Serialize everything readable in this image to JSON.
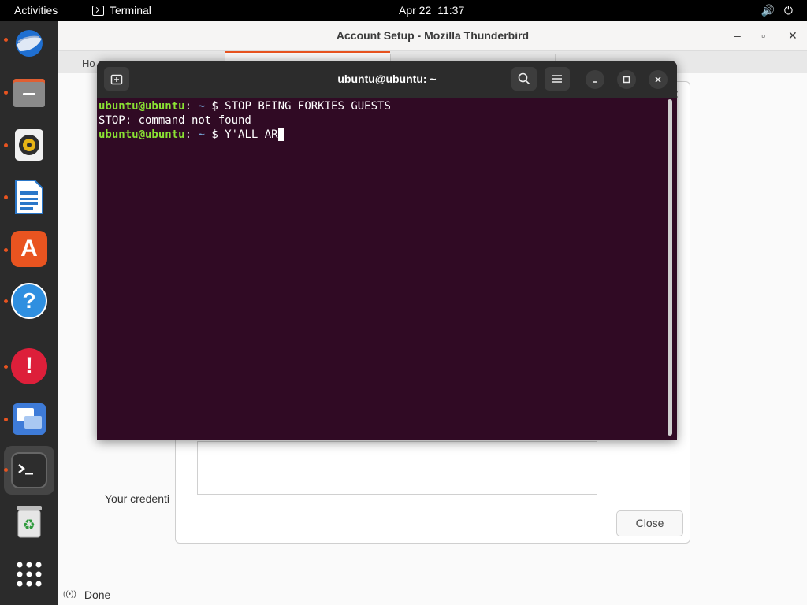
{
  "topbar": {
    "activities": "Activities",
    "app_name": "Terminal",
    "date": "Apr 22",
    "time": "11:37",
    "volume_icon": "🔊",
    "power_icon": "⏻"
  },
  "dock": {
    "items": [
      {
        "name": "thunderbird",
        "running": true
      },
      {
        "name": "files",
        "running": true
      },
      {
        "name": "rhythmbox",
        "running": true
      },
      {
        "name": "libreoffice-writer",
        "running": true
      },
      {
        "name": "app-center",
        "running": true
      },
      {
        "name": "help",
        "running": true
      },
      {
        "name": "update-notifier",
        "running": true
      },
      {
        "name": "workspaces",
        "running": true
      },
      {
        "name": "terminal",
        "running": true,
        "active": true
      },
      {
        "name": "trash",
        "running": false
      }
    ],
    "apps_grid": "show-apps",
    "help_glyph": "?",
    "alert_glyph": "!",
    "software_glyph": "A",
    "trash_glyph": "♻"
  },
  "thunderbird": {
    "title": "Account Setup - Mozilla Thunderbird",
    "controls": {
      "minimize": "–",
      "maximize": "▫",
      "close": "✕"
    },
    "tabs": [
      {
        "label": "Ho"
      }
    ],
    "status_text": "Done",
    "status_icon": "((•))"
  },
  "dialog": {
    "close_button": "Close",
    "partial_text": "Your credenti"
  },
  "terminal": {
    "title": "ubuntu@ubuntu: ~",
    "lines": [
      {
        "user": "ubuntu@ubuntu",
        "sep": ":",
        "path": " ~",
        "prompt": "$ ",
        "command": "STOP BEING FORKIES GUESTS"
      },
      {
        "output": "STOP: command not found"
      },
      {
        "user": "ubuntu@ubuntu",
        "sep": ":",
        "path": " ~",
        "prompt": "$ ",
        "command": "Y'ALL AR"
      }
    ]
  },
  "colors": {
    "terminal_bg": "#300a24",
    "prompt_user": "#8ae234",
    "prompt_path": "#729fcf",
    "ubuntu_orange": "#e95420"
  }
}
